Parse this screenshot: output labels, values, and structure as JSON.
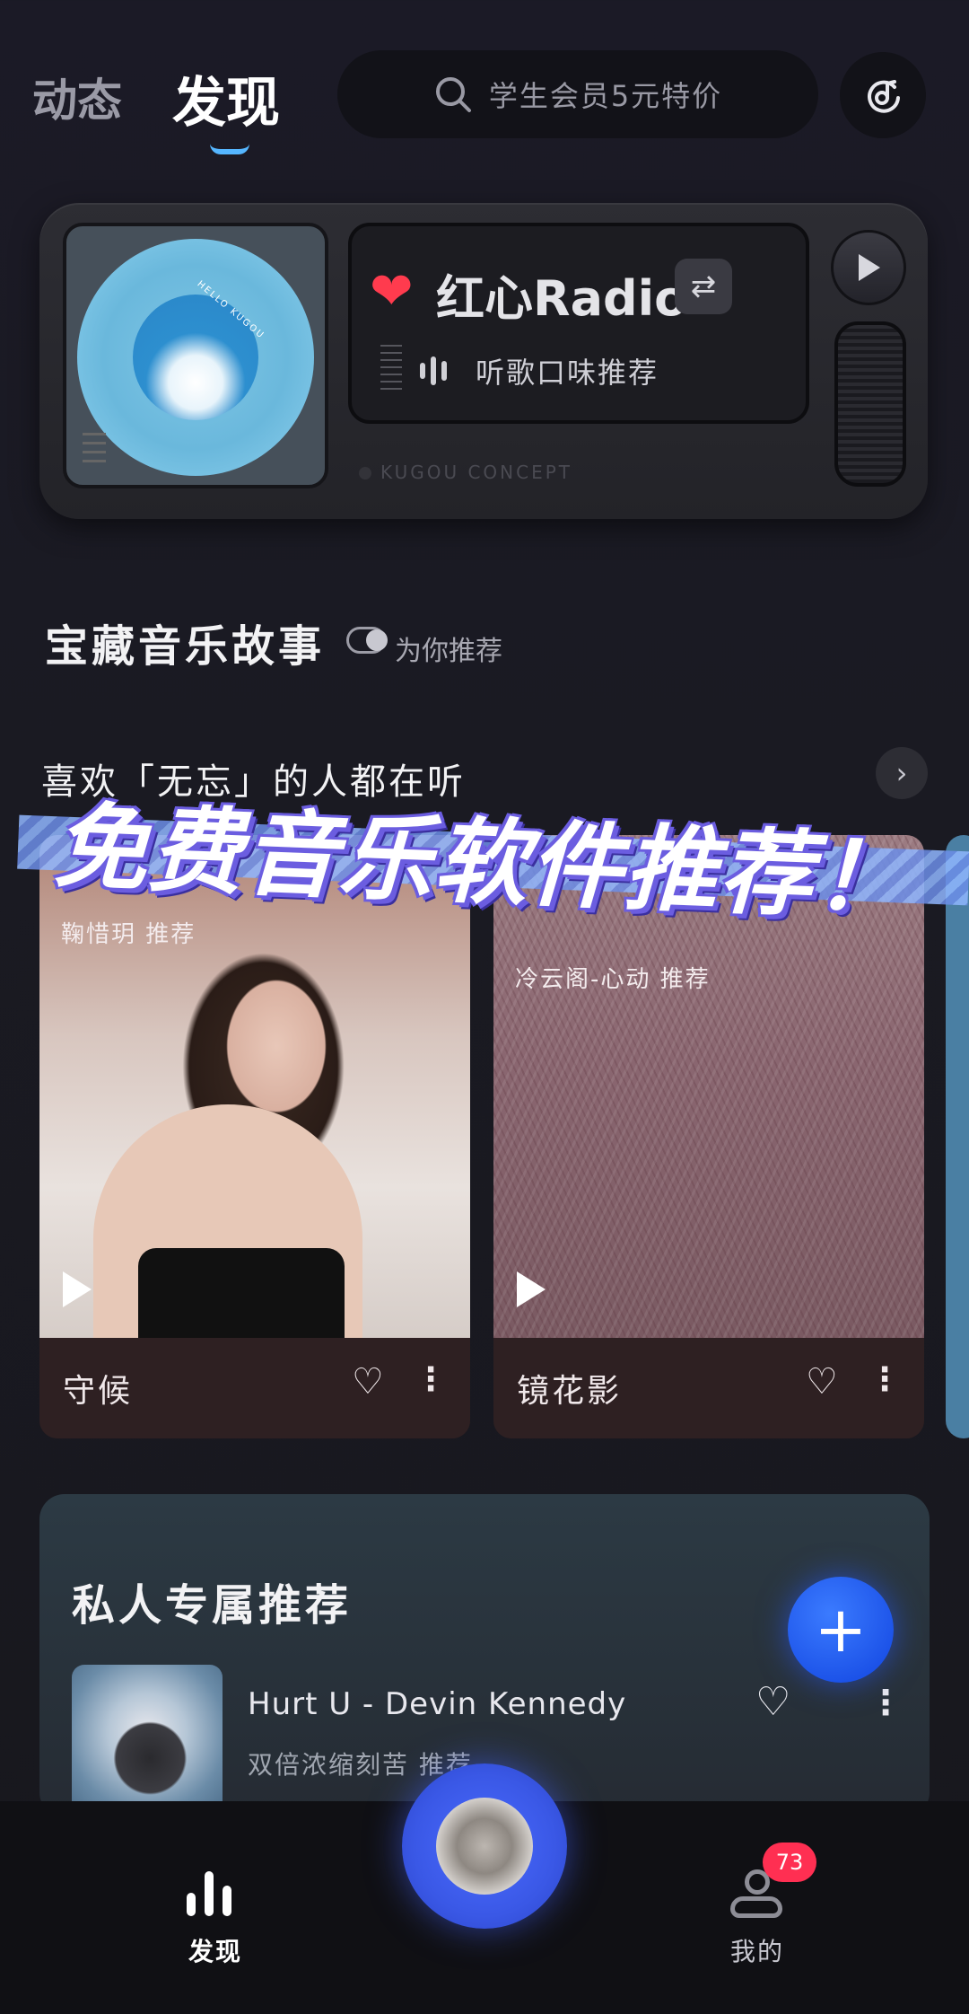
{
  "top_nav": {
    "tab_dynamic": "动态",
    "tab_discover": "发现",
    "search_placeholder": "学生会员5元特价"
  },
  "radio": {
    "title": "红心Radio",
    "subtitle": "听歌口味推荐",
    "brand": "KUGOU CONCEPT",
    "disc_text": "HELLO KUGOU"
  },
  "section_treasure": {
    "title": "宝藏音乐故事",
    "sub": "为你推荐"
  },
  "section_like": {
    "title": "喜欢「无忘」的人都在听"
  },
  "cards": [
    {
      "recommender": "鞠惜玥 推荐",
      "name": "守候"
    },
    {
      "recommender": "冷云阁-心动 推荐",
      "name": "镜花影"
    }
  ],
  "banner": {
    "text": "免费音乐软件推荐！"
  },
  "private_rec": {
    "title": "私人专属推荐",
    "song_title": "Hurt U - Devin Kennedy",
    "song_sub": "双倍浓缩刻苦 推荐"
  },
  "bottom_bar": {
    "discover_label": "发现",
    "me_label": "我的",
    "badge_count": "73"
  },
  "colors": {
    "accent": "#55b6ff",
    "heart": "#ff3b4e",
    "fab": "#1a55f0",
    "badge": "#ff2f52"
  }
}
